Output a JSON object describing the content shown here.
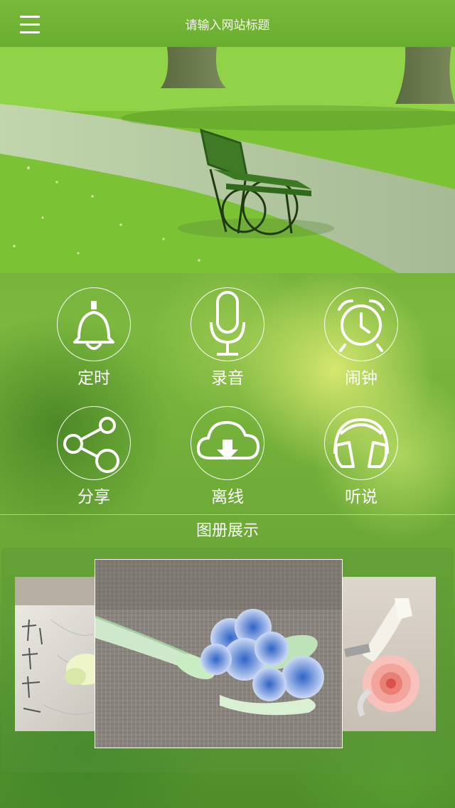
{
  "header": {
    "title": "请输入网站标题",
    "menu_icon": "hamburger-menu-icon"
  },
  "features": [
    {
      "icon": "bell-icon",
      "label": "定时"
    },
    {
      "icon": "microphone-icon",
      "label": "录音"
    },
    {
      "icon": "alarm-clock-icon",
      "label": "闹钟"
    },
    {
      "icon": "share-icon",
      "label": "分享"
    },
    {
      "icon": "cloud-download-icon",
      "label": "离线"
    },
    {
      "icon": "headphones-icon",
      "label": "听说"
    }
  ],
  "album": {
    "title": "图册展示"
  },
  "colors": {
    "primary_green": "#6aae30",
    "text": "#ffffff"
  }
}
